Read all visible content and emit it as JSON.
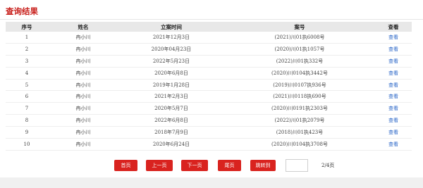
{
  "header": {
    "title": "查询结果"
  },
  "table": {
    "columns": [
      "序号",
      "姓名",
      "立案时间",
      "案号",
      "查看"
    ],
    "rows": [
      {
        "no": "1",
        "name": "冉小川",
        "date": "2021年12月3日",
        "case": "(2021)川01执6008号",
        "view": "查看"
      },
      {
        "no": "2",
        "name": "冉小川",
        "date": "2020年04月23日",
        "case": "(2020)川01执1057号",
        "view": "查看"
      },
      {
        "no": "3",
        "name": "冉小川",
        "date": "2022年5月23日",
        "case": "(2022)川01执332号",
        "view": "查看"
      },
      {
        "no": "4",
        "name": "冉小川",
        "date": "2020年6月8日",
        "case": "(2020)川0104执3442号",
        "view": "查看"
      },
      {
        "no": "5",
        "name": "冉小川",
        "date": "2019年1月28日",
        "case": "(2019)川0107执936号",
        "view": "查看"
      },
      {
        "no": "6",
        "name": "冉小川",
        "date": "2021年2月3日",
        "case": "(2021)川0118执690号",
        "view": "查看"
      },
      {
        "no": "7",
        "name": "冉小川",
        "date": "2020年5月7日",
        "case": "(2020)川0191执2303号",
        "view": "查看"
      },
      {
        "no": "8",
        "name": "冉小川",
        "date": "2022年6月8日",
        "case": "(2022)川01执2079号",
        "view": "查看"
      },
      {
        "no": "9",
        "name": "冉小川",
        "date": "2018年7月9日",
        "case": "(2018)川01执423号",
        "view": "查看"
      },
      {
        "no": "10",
        "name": "冉小川",
        "date": "2020年6月24日",
        "case": "(2020)川0104执3708号",
        "view": "查看"
      }
    ]
  },
  "pagination": {
    "first": "首页",
    "prev": "上一页",
    "next": "下一页",
    "last": "尾页",
    "jump": "跳转到",
    "jump_value": "",
    "page_info": "2/4页"
  },
  "colors": {
    "accent": "#d9231f",
    "title": "#c8201c",
    "link": "#2a66c7",
    "header_bg": "#e8e8e8"
  }
}
